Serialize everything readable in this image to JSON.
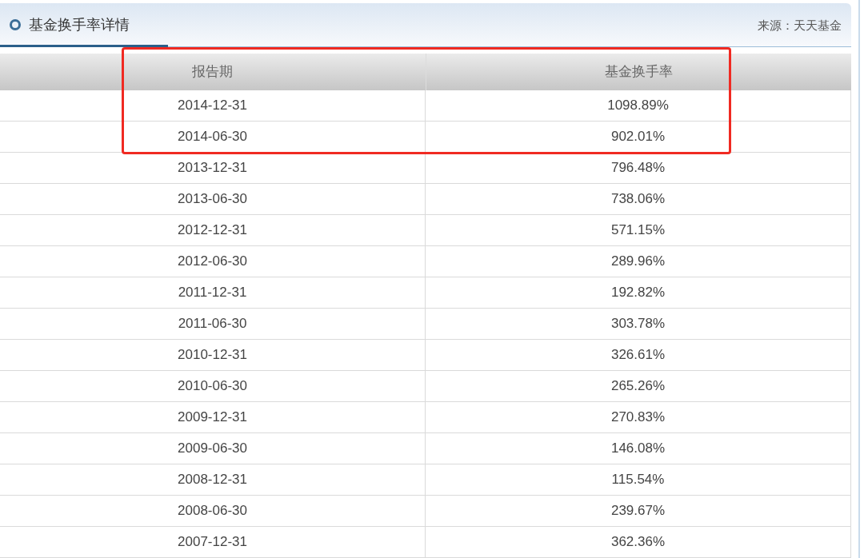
{
  "panel": {
    "title": "基金换手率详情",
    "source": "来源：天天基金"
  },
  "table": {
    "columns": [
      "报告期",
      "基金换手率"
    ],
    "rows": [
      [
        "2014-12-31",
        "1098.89%"
      ],
      [
        "2014-06-30",
        "902.01%"
      ],
      [
        "2013-12-31",
        "796.48%"
      ],
      [
        "2013-06-30",
        "738.06%"
      ],
      [
        "2012-12-31",
        "571.15%"
      ],
      [
        "2012-06-30",
        "289.96%"
      ],
      [
        "2011-12-31",
        "192.82%"
      ],
      [
        "2011-06-30",
        "303.78%"
      ],
      [
        "2010-12-31",
        "326.61%"
      ],
      [
        "2010-06-30",
        "265.26%"
      ],
      [
        "2009-12-31",
        "270.83%"
      ],
      [
        "2009-06-30",
        "146.08%"
      ],
      [
        "2008-12-31",
        "115.54%"
      ],
      [
        "2008-06-30",
        "239.67%"
      ],
      [
        "2007-12-31",
        "362.36%"
      ]
    ]
  }
}
